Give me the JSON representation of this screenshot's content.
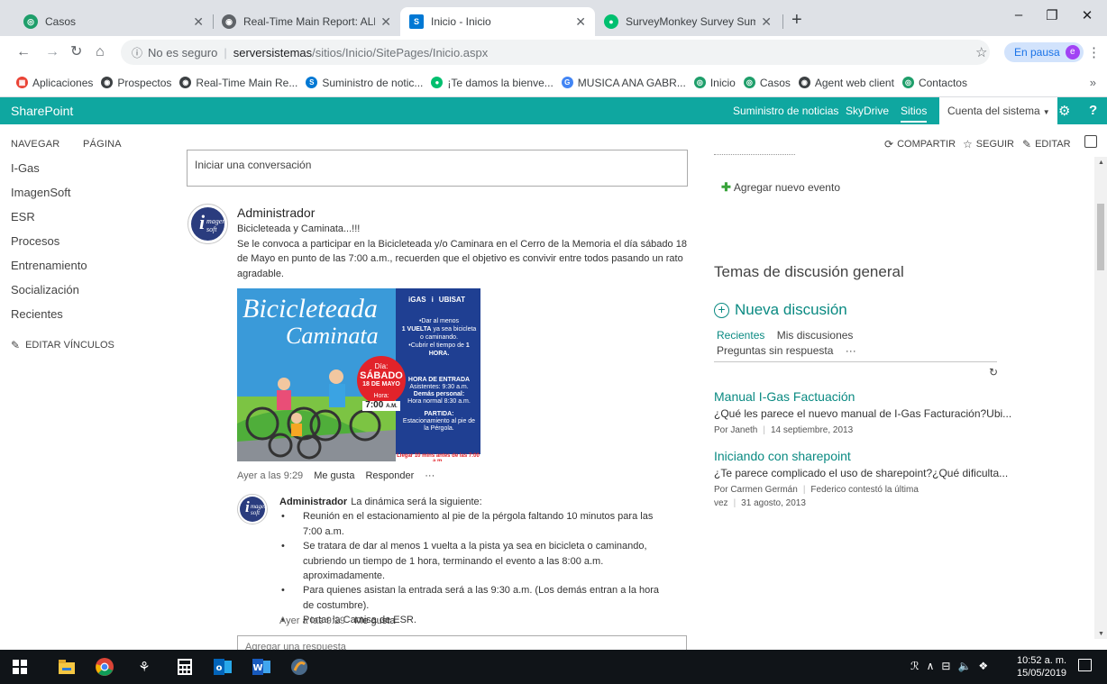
{
  "browser": {
    "tabs": [
      {
        "title": "Casos",
        "favicon_color": "#1e9e6a"
      },
      {
        "title": "Real-Time Main Report: ALL-ACTI",
        "favicon_color": "#5f6368"
      },
      {
        "title": "Inicio - Inicio",
        "favicon_color": "#0078d4"
      },
      {
        "title": "SurveyMonkey Survey Summary",
        "favicon_color": "#00bf6f"
      }
    ],
    "new_tab_icon": "plus-icon",
    "window_controls": {
      "minimize": "–",
      "restore": "❐",
      "close": "✕"
    },
    "omnibox": {
      "security_label": "No es seguro",
      "host": "serversistemas",
      "path": "/sitios/Inicio/SitePages/Inicio.aspx"
    },
    "profile": {
      "label": "En pausa",
      "initial": "e"
    },
    "bookmarks": [
      {
        "label": "Aplicaciones",
        "color": "#ea4335",
        "glyph": "▦"
      },
      {
        "label": "Prospectos",
        "color": "#3c4043",
        "glyph": "◉"
      },
      {
        "label": "Real-Time Main Re...",
        "color": "#3c4043",
        "glyph": "◉"
      },
      {
        "label": "Suministro de notic...",
        "color": "#0078d4",
        "glyph": "S"
      },
      {
        "label": "¡Te damos la bienve...",
        "color": "#00bf6f",
        "glyph": "●"
      },
      {
        "label": "MUSICA ANA GABR...",
        "color": "#4285f4",
        "glyph": "G"
      },
      {
        "label": "Inicio",
        "color": "#1e9e6a",
        "glyph": "◎"
      },
      {
        "label": "Casos",
        "color": "#1e9e6a",
        "glyph": "◎"
      },
      {
        "label": "Agent web client",
        "color": "#3c4043",
        "glyph": "◉"
      },
      {
        "label": "Contactos",
        "color": "#1e9e6a",
        "glyph": "◎"
      }
    ],
    "bookmarks_more": "»"
  },
  "suitebar": {
    "brand": "SharePoint",
    "links": [
      "Suministro de noticias",
      "SkyDrive",
      "Sitios"
    ],
    "account": "Cuenta del sistema",
    "help": "?"
  },
  "ribbon": {
    "tabs": [
      "NAVEGAR",
      "PÁGINA"
    ],
    "actions": {
      "share": "COMPARTIR",
      "follow": "SEGUIR",
      "edit": "EDITAR"
    }
  },
  "leftnav": {
    "items": [
      "I-Gas",
      "ImagenSoft",
      "ESR",
      "Procesos",
      "Entrenamiento",
      "Socialización",
      "Recientes"
    ],
    "edit_links": "EDITAR VÍNCULOS"
  },
  "feed": {
    "start_conversation": "Iniciar una conversación",
    "post": {
      "author": "Administrador",
      "title": "Bicicleteada y Caminata...!!!",
      "body": "Se le convoca a participar en la Bicicleteada y/o Caminara en el Cerro de la Memoria el día sábado 18 de Mayo en punto de las 7:00 a.m., recuerden que el objetivo es convivir entre todos pasando un rato agradable.",
      "time": "Ayer a las 9:29",
      "like": "Me gusta",
      "reply": "Responder",
      "more": "···"
    },
    "poster": {
      "title1": "Bicicleteada",
      "title2": "Caminata",
      "logos": [
        "iGAS",
        "i",
        "UBISAT"
      ],
      "bullet1_pre": "•Dar al menos",
      "bullet1_bold": "1 VUELTA",
      "bullet1_post": "ya sea bicicleta o caminando.",
      "bullet2_pre": "•Cubrir el tiempo de",
      "bullet2_bold": "1 HORA.",
      "day_label": "Día:",
      "day": "SÁBADO",
      "date": "18 DE MAYO",
      "hour_label": "Hora:",
      "hour": "7:00",
      "hour_suffix": "A.M.",
      "entry_title": "HORA DE ENTRADA",
      "entry_line1": "Asistentes: 9:30 a.m.",
      "entry_line2": "Demás personal:",
      "entry_line3": "Hora normal 8:30 a.m.",
      "departure_title": "PARTIDA:",
      "departure_body": "Estacionamiento al pie de la Pérgola.",
      "footer": "Llegar 10 mins antes de las 7:00 a.m."
    },
    "reply": {
      "author": "Administrador",
      "intro": "La dinámica será la siguiente:",
      "bullets": [
        "Reunión en el estacionamiento al pie de la pérgola faltando 10 minutos para las 7:00 a.m.",
        "Se tratara de dar al menos 1 vuelta a la pista ya sea en bicicleta o caminando, cubriendo un tiempo de 1 hora, terminando el evento a las 8:00 a.m. aproximadamente.",
        "Para quienes asistan la entrada será a las 9:30 a.m. (Los demás entran a la hora de costumbre).",
        "Portar la Camisa de ESR."
      ],
      "time": "Ayer a las 9:29",
      "like": "Me gusta"
    },
    "reply_placeholder": "Agregar una respuesta"
  },
  "right": {
    "add_event": "Agregar nuevo evento",
    "discussions_title": "Temas de discusión general",
    "new_discussion": "Nueva discusión",
    "tabs": {
      "recent": "Recientes",
      "mine": "Mis discusiones",
      "unanswered": "Preguntas sin respuesta",
      "more": "···"
    },
    "items": [
      {
        "title": "Manual I-Gas Factuación",
        "body": "¿Qué les parece el nuevo manual de I-Gas Facturación?Ubi...",
        "by": "Por Janeth",
        "date": "14 septiembre, 2013"
      },
      {
        "title": "Iniciando con sharepoint",
        "body": "¿Te parece complicado el uso de sharepoint?¿Qué dificulta...",
        "by": "Por Carmen Germán",
        "last": "Federico contestó la última vez",
        "date": "31 agosto, 2013"
      }
    ]
  },
  "taskbar": {
    "icons": [
      "windows-icon",
      "file-explorer-icon",
      "chrome-icon",
      "app-icon",
      "calculator-icon",
      "outlook-icon",
      "word-icon",
      "media-icon"
    ],
    "time": "10:52 a. m.",
    "date": "15/05/2019"
  }
}
